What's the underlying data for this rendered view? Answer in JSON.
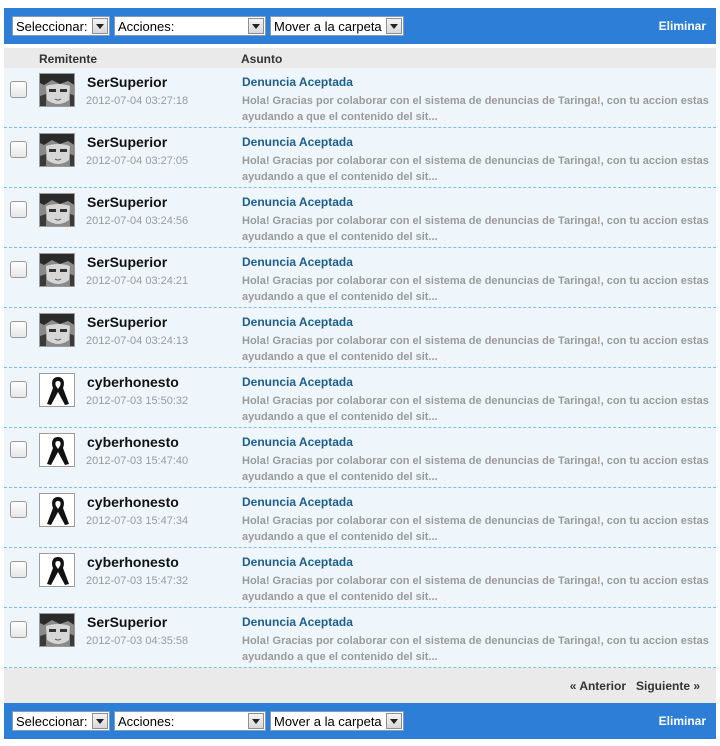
{
  "toolbar": {
    "select_label": "Seleccionar:",
    "actions_label": "Acciones:",
    "move_label": "Mover a la carpeta",
    "delete_label": "Eliminar"
  },
  "columns": {
    "sender": "Remitente",
    "subject": "Asunto"
  },
  "messages": [
    {
      "sender": "SerSuperior",
      "avatar": "manga-face-icon",
      "date": "2012-07-04 03:27:18",
      "subject": "Denuncia Aceptada",
      "preview": "Hola! Gracias por colaborar con el sistema de denuncias de Taringa!, con tu accion estas ayudando a que el contenido del sit..."
    },
    {
      "sender": "SerSuperior",
      "avatar": "manga-face-icon",
      "date": "2012-07-04 03:27:05",
      "subject": "Denuncia Aceptada",
      "preview": "Hola! Gracias por colaborar con el sistema de denuncias de Taringa!, con tu accion estas ayudando a que el contenido del sit..."
    },
    {
      "sender": "SerSuperior",
      "avatar": "manga-face-icon",
      "date": "2012-07-04 03:24:56",
      "subject": "Denuncia Aceptada",
      "preview": "Hola! Gracias por colaborar con el sistema de denuncias de Taringa!, con tu accion estas ayudando a que el contenido del sit..."
    },
    {
      "sender": "SerSuperior",
      "avatar": "manga-face-icon",
      "date": "2012-07-04 03:24:21",
      "subject": "Denuncia Aceptada",
      "preview": "Hola! Gracias por colaborar con el sistema de denuncias de Taringa!, con tu accion estas ayudando a que el contenido del sit..."
    },
    {
      "sender": "SerSuperior",
      "avatar": "manga-face-icon",
      "date": "2012-07-04 03:24:13",
      "subject": "Denuncia Aceptada",
      "preview": "Hola! Gracias por colaborar con el sistema de denuncias de Taringa!, con tu accion estas ayudando a que el contenido del sit..."
    },
    {
      "sender": "cyberhonesto",
      "avatar": "ribbon-icon",
      "date": "2012-07-03 15:50:32",
      "subject": "Denuncia Aceptada",
      "preview": "Hola! Gracias por colaborar con el sistema de denuncias de Taringa!, con tu accion estas ayudando a que el contenido del sit..."
    },
    {
      "sender": "cyberhonesto",
      "avatar": "ribbon-icon",
      "date": "2012-07-03 15:47:40",
      "subject": "Denuncia Aceptada",
      "preview": "Hola! Gracias por colaborar con el sistema de denuncias de Taringa!, con tu accion estas ayudando a que el contenido del sit..."
    },
    {
      "sender": "cyberhonesto",
      "avatar": "ribbon-icon",
      "date": "2012-07-03 15:47:34",
      "subject": "Denuncia Aceptada",
      "preview": "Hola! Gracias por colaborar con el sistema de denuncias de Taringa!, con tu accion estas ayudando a que el contenido del sit..."
    },
    {
      "sender": "cyberhonesto",
      "avatar": "ribbon-icon",
      "date": "2012-07-03 15:47:32",
      "subject": "Denuncia Aceptada",
      "preview": "Hola! Gracias por colaborar con el sistema de denuncias de Taringa!, con tu accion estas ayudando a que el contenido del sit..."
    },
    {
      "sender": "SerSuperior",
      "avatar": "manga-face-icon",
      "date": "2012-07-03 04:35:58",
      "subject": "Denuncia Aceptada",
      "preview": "Hola! Gracias por colaborar con el sistema de denuncias de Taringa!, con tu accion estas ayudando a que el contenido del sit..."
    }
  ],
  "pager": {
    "prev_label": "« Anterior",
    "next_label": "Siguiente »"
  },
  "colors": {
    "toolbar_bg": "#2c7ed6",
    "row_bg": "#eef6fc",
    "row_divider": "#7cc2d4",
    "subject": "#1c5e8f",
    "meta_gray": "#9a9a9a"
  }
}
